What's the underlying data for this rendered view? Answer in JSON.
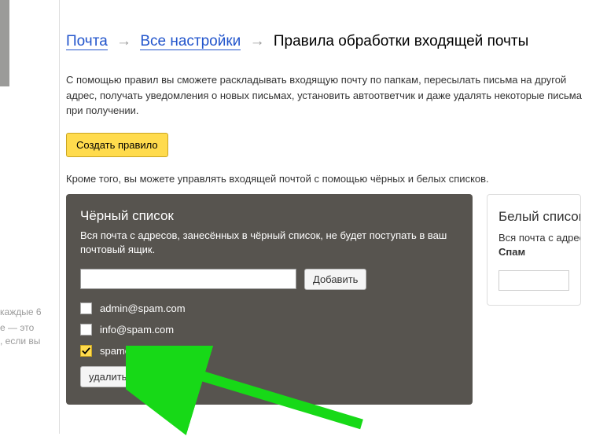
{
  "sidebar_fragments": {
    "line1": "каждые 6",
    "line2": "е — это",
    "line3": ", если вы"
  },
  "breadcrumb": {
    "mail": "Почта",
    "all_settings": "Все настройки",
    "current": "Правила обработки входящей почты"
  },
  "intro_text": "С помощью правил вы сможете раскладывать входящую почту по папкам, пересылать письма на другой адрес, получать уведомления о новых письмах, установить автоответчик и даже удалять некоторые письма при получении.",
  "create_rule_label": "Создать правило",
  "note_text": "Кроме того, вы можете управлять входящей почтой с помощью чёрных и белых списков.",
  "blacklist": {
    "title": "Чёрный список",
    "desc": "Вся почта с адресов, занесённых в чёрный список, не будет поступать в ваш почтовый ящик.",
    "add_label": "Добавить",
    "remove_label": "удалить из списка",
    "entries": [
      {
        "email": "admin@spam.com",
        "checked": false
      },
      {
        "email": "info@spam.com",
        "checked": false
      },
      {
        "email": "spamer@spam.com",
        "checked": true
      }
    ]
  },
  "whitelist": {
    "title": "Белый список",
    "desc_prefix": "Вся почта с адресов",
    "desc_bold": "Спам"
  }
}
